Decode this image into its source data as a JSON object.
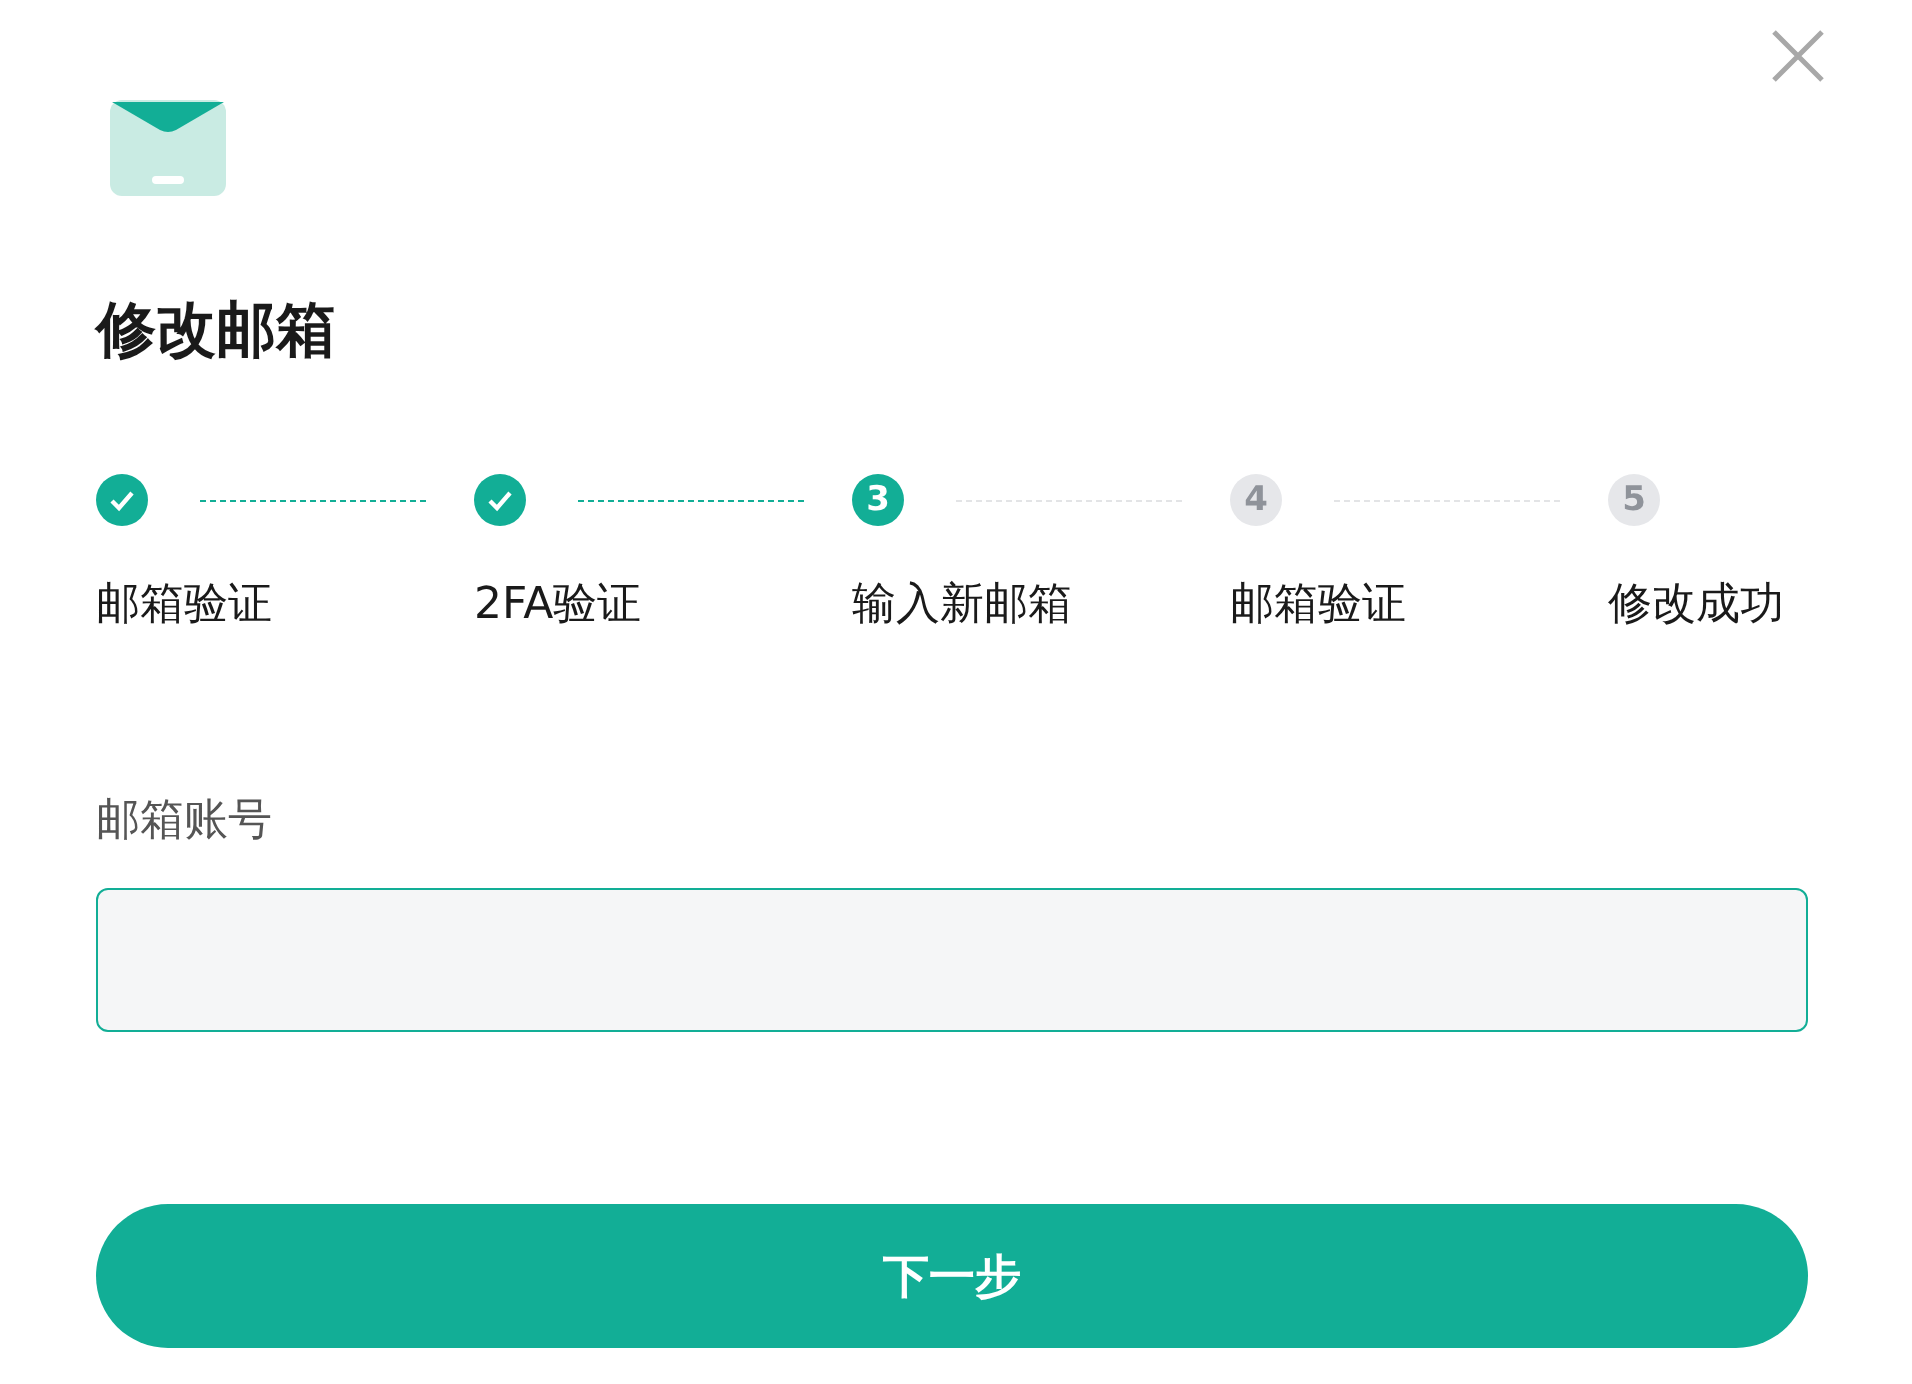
{
  "title": "修改邮箱",
  "steps": [
    {
      "label": "邮箱验证",
      "kind": "done"
    },
    {
      "label": "2FA验证",
      "kind": "done"
    },
    {
      "label": "输入新邮箱",
      "kind": "current",
      "number": "3"
    },
    {
      "label": "邮箱验证",
      "kind": "pending",
      "number": "4"
    },
    {
      "label": "修改成功",
      "kind": "pending",
      "number": "5"
    }
  ],
  "field": {
    "label": "邮箱账号"
  },
  "button": "下一步"
}
